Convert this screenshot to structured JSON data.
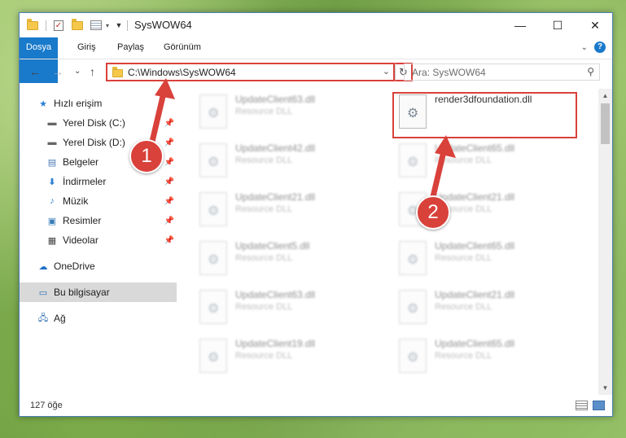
{
  "window": {
    "title": "SysWOW64",
    "controls": {
      "minimize": "—",
      "maximize": "☐",
      "close": "✕"
    }
  },
  "ribbon": {
    "tabs": [
      "Dosya",
      "Giriş",
      "Paylaş",
      "Görünüm"
    ],
    "accent": "#1979ca"
  },
  "nav": {
    "back": "←",
    "forward": "→",
    "recent": "⌄",
    "up": "↑",
    "address": "C:\\Windows\\SysWOW64",
    "search_placeholder": "Ara: SysWOW64"
  },
  "sidebar": {
    "items": [
      {
        "label": "Hızlı erişim",
        "icon": "star-icon",
        "pinned": false
      },
      {
        "label": "Yerel Disk (C:)",
        "icon": "drive-icon",
        "pinned": true
      },
      {
        "label": "Yerel Disk (D:)",
        "icon": "drive-icon",
        "pinned": true
      },
      {
        "label": "Belgeler",
        "icon": "documents-icon",
        "pinned": true
      },
      {
        "label": "İndirmeler",
        "icon": "download-icon",
        "pinned": true
      },
      {
        "label": "Müzik",
        "icon": "music-icon",
        "pinned": true
      },
      {
        "label": "Resimler",
        "icon": "pictures-icon",
        "pinned": true
      },
      {
        "label": "Videolar",
        "icon": "videos-icon",
        "pinned": true
      },
      {
        "label": "OneDrive",
        "icon": "cloud-icon",
        "pinned": false
      },
      {
        "label": "Bu bilgisayar",
        "icon": "computer-icon",
        "pinned": false,
        "selected": true
      },
      {
        "label": "Ağ",
        "icon": "network-icon",
        "pinned": false
      }
    ]
  },
  "files": [
    {
      "name": "UpdateClient63.dll",
      "type": "Resource DLL",
      "blurred": true
    },
    {
      "name": "render3dfoundation.dll",
      "type": "",
      "blurred": false,
      "highlighted": true
    },
    {
      "name": "UpdateClient42.dll",
      "type": "Resource DLL",
      "blurred": true
    },
    {
      "name": "UpdateClient65.dll",
      "type": "Resource DLL",
      "blurred": true
    },
    {
      "name": "UpdateClient21.dll",
      "type": "Resource DLL",
      "blurred": true
    },
    {
      "name": "UpdateClient21.dll",
      "type": "Resource DLL",
      "blurred": true
    },
    {
      "name": "UpdateClient5.dll",
      "type": "Resource DLL",
      "blurred": true
    },
    {
      "name": "UpdateClient65.dll",
      "type": "Resource DLL",
      "blurred": true
    },
    {
      "name": "UpdateClient63.dll",
      "type": "Resource DLL",
      "blurred": true
    },
    {
      "name": "UpdateClient21.dll",
      "type": "Resource DLL",
      "blurred": true
    },
    {
      "name": "UpdateClient19.dll",
      "type": "Resource DLL",
      "blurred": true
    },
    {
      "name": "UpdateClient65.dll",
      "type": "Resource DLL",
      "blurred": true
    }
  ],
  "status": {
    "count": "127 öğe"
  },
  "callouts": [
    {
      "number": "1",
      "target": "address-bar"
    },
    {
      "number": "2",
      "target": "render3dfoundation.dll"
    }
  ],
  "colors": {
    "callout": "#d9413b"
  }
}
